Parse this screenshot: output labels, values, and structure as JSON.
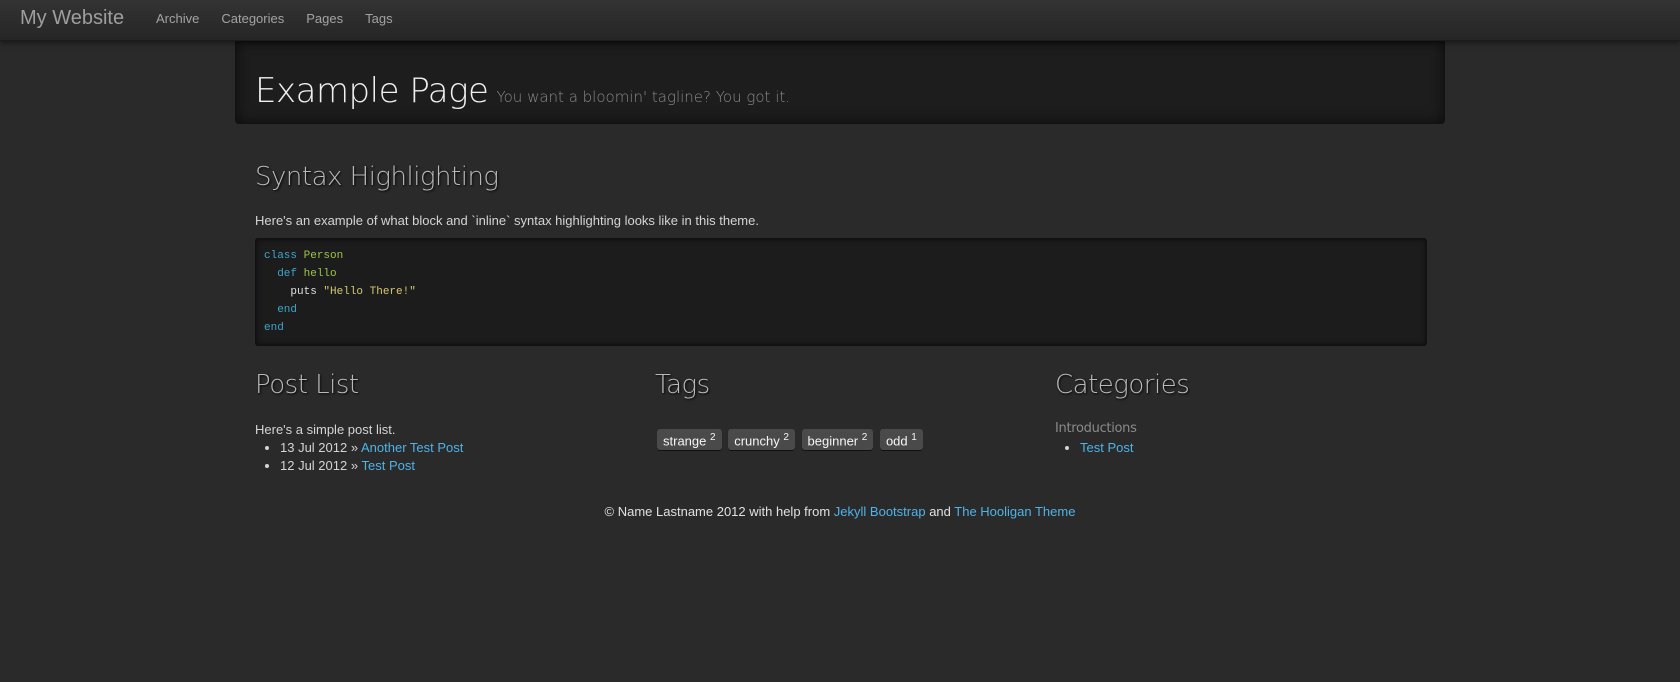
{
  "navbar": {
    "brand": "My Website",
    "links": [
      "Archive",
      "Categories",
      "Pages",
      "Tags"
    ]
  },
  "hero": {
    "title": "Example Page",
    "tagline": "You want a bloomin' tagline? You got it."
  },
  "syntax": {
    "heading": "Syntax Highlighting",
    "intro": "Here's an example of what block and `inline` syntax highlighting looks like in this theme.",
    "code": {
      "line1_kw": "class",
      "line1_name": "Person",
      "line2_kw": "def",
      "line2_name": "hello",
      "line3_fn": "puts",
      "line3_str": "\"Hello There!\"",
      "line4_kw": "end",
      "line5_kw": "end"
    }
  },
  "post_list": {
    "heading": "Post List",
    "intro": "Here's a simple post list.",
    "posts": [
      {
        "date": "13 Jul 2012",
        "sep": "»",
        "title": "Another Test Post"
      },
      {
        "date": "12 Jul 2012",
        "sep": "»",
        "title": "Test Post"
      }
    ]
  },
  "tags": {
    "heading": "Tags",
    "items": [
      {
        "name": "strange",
        "count": "2"
      },
      {
        "name": "crunchy",
        "count": "2"
      },
      {
        "name": "beginner",
        "count": "2"
      },
      {
        "name": "odd",
        "count": "1"
      }
    ]
  },
  "categories": {
    "heading": "Categories",
    "group": "Introductions",
    "items": [
      "Test Post"
    ]
  },
  "footer": {
    "prefix": "© Name Lastname 2012 with help from",
    "link1": "Jekyll Bootstrap",
    "and": "and",
    "link2": "The Hooligan Theme"
  },
  "colors": {
    "background": "#2a2a2b",
    "link": "#4fb3e6",
    "keyword": "#3fa5c9",
    "class_name": "#9bc44a",
    "string": "#d3c76f"
  }
}
